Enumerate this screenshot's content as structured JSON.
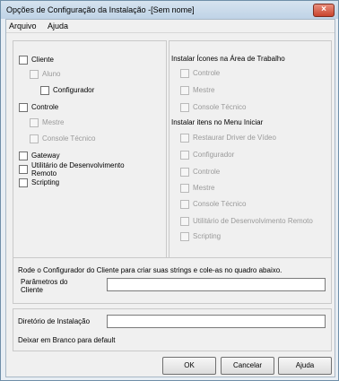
{
  "window": {
    "title": "Opções de Configuração da Instalação -[Sem nome]",
    "close_glyph": "×"
  },
  "menu": {
    "file": "Arquivo",
    "help": "Ajuda"
  },
  "components": {
    "client": "Cliente",
    "student": "Aluno",
    "configurator": "Configurador",
    "control": "Controle",
    "master": "Mestre",
    "tech_console": "Console Técnico",
    "gateway": "Gateway",
    "remote_dev_utility_line1": "Utilitário de Desenvolvimento",
    "remote_dev_utility_line2": "Remoto",
    "scripting": "Scripting"
  },
  "desktop_icons": {
    "heading": "Instalar Ícones na Área de Trabalho",
    "control": "Controle",
    "master": "Mestre",
    "tech_console": "Console Técnico"
  },
  "start_menu": {
    "heading": "Instalar itens no Menu Iniciar",
    "restore_video_driver": "Restaurar Driver de Vídeo",
    "configurator": "Configurador",
    "control": "Controle",
    "master": "Mestre",
    "tech_console": "Console Técnico",
    "remote_dev_utility": "Utilitário de Desenvolvimento Remoto",
    "scripting": "Scripting"
  },
  "client_params": {
    "instruction": "Rode o Configurador do Cliente para criar suas strings e cole-as no quadro abaixo.",
    "label_line1": "Parâmetros do",
    "label_line2": "Cliente",
    "value": ""
  },
  "install_dir": {
    "label": "Diretório de Instalação",
    "value": "",
    "hint": "Deixar em Branco para default"
  },
  "buttons": {
    "ok": "OK",
    "cancel": "Cancelar",
    "help": "Ajuda"
  }
}
